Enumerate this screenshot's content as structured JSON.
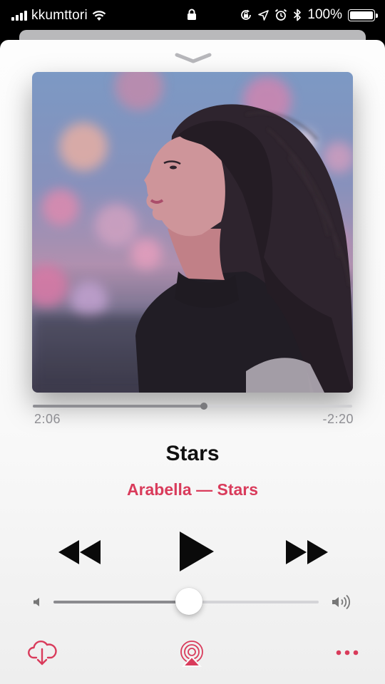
{
  "status_bar": {
    "carrier": "kkumttori",
    "battery_percent": "100%",
    "battery_level": 1.0,
    "icons": [
      "signal-icon",
      "wifi-icon",
      "lock-icon",
      "orientation-lock-icon",
      "location-icon",
      "alarm-icon",
      "bluetooth-icon",
      "battery-icon"
    ]
  },
  "now_playing": {
    "song_title": "Stars",
    "artist_album": "Arabella — Stars",
    "elapsed": "2:06",
    "remaining": "-2:20",
    "progress_fraction": 0.536,
    "volume_fraction": 0.51
  },
  "controls": {
    "icons": [
      "chevron-down-icon",
      "rewind-icon",
      "play-icon",
      "fast-forward-icon",
      "volume-low-icon",
      "volume-high-icon",
      "cloud-download-icon",
      "airplay-icon",
      "more-icon"
    ]
  },
  "colors": {
    "accent": "#d93b5b",
    "progress": "#8e8e93",
    "text_primary": "#111111"
  }
}
